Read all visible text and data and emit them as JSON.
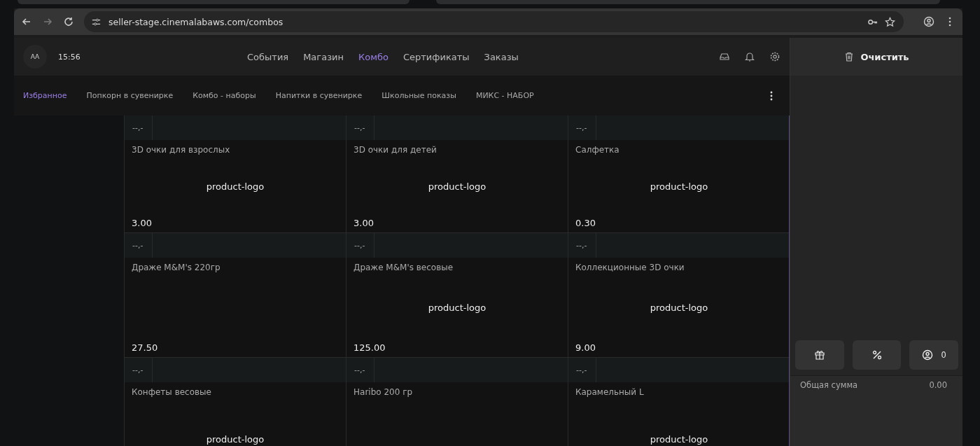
{
  "browser": {
    "url": "seller-stage.cinemalabaws.com/combos"
  },
  "header": {
    "avatar": "AA",
    "time": "15:56",
    "nav": [
      {
        "label": "События",
        "selected": false
      },
      {
        "label": "Магазин",
        "selected": false
      },
      {
        "label": "Комбо",
        "selected": true
      },
      {
        "label": "Сертификаты",
        "selected": false
      },
      {
        "label": "Заказы",
        "selected": false
      }
    ]
  },
  "categories": [
    {
      "label": "Избранное",
      "selected": true
    },
    {
      "label": "Попкорн в сувенирке",
      "selected": false
    },
    {
      "label": "Комбо - наборы",
      "selected": false
    },
    {
      "label": "Напитки в сувенирке",
      "selected": false
    },
    {
      "label": "Школьные показы",
      "selected": false
    },
    {
      "label": "МИКС - НАБОР",
      "selected": false
    }
  ],
  "products": [
    {
      "badge": "--,-",
      "name": "3D очки для взрослых",
      "image_alt": "product-logo",
      "price": "3.00"
    },
    {
      "badge": "--,-",
      "name": "3D очки для детей",
      "image_alt": "product-logo",
      "price": "3.00"
    },
    {
      "badge": "--,-",
      "name": "Салфетка",
      "image_alt": "product-logo",
      "price": "0.30"
    },
    {
      "badge": "--,-",
      "name": "Драже M&M's 220гр",
      "price": "27.50"
    },
    {
      "badge": "--,-",
      "name": "Драже M&M's весовые",
      "image_alt": "product-logo",
      "price": "125.00"
    },
    {
      "badge": "--,-",
      "name": "Коллекционные 3D очки",
      "image_alt": "product-logo",
      "price": "9.00"
    },
    {
      "badge": "--,-",
      "name": "Конфеты весовые",
      "image_alt": "product-logo"
    },
    {
      "badge": "--,-",
      "name": "Haribo 200 гр"
    },
    {
      "badge": "--,-",
      "name": "Карамельный L",
      "image_alt": "product-logo"
    }
  ],
  "cart": {
    "clear_button": "Очистить",
    "customer_count": "0",
    "total_label": "Общая сумма",
    "total": "0.00"
  }
}
